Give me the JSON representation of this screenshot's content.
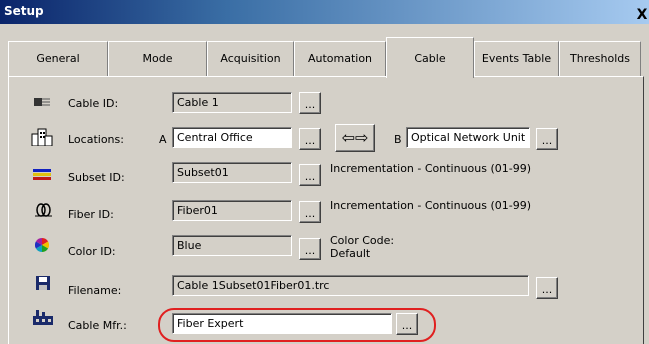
{
  "window": {
    "title": "Setup",
    "close_glyph": "X"
  },
  "tabs": [
    {
      "label": "General"
    },
    {
      "label": "Mode"
    },
    {
      "label": "Acquisition"
    },
    {
      "label": "Automation"
    },
    {
      "label": "Cable",
      "active": true
    },
    {
      "label": "Events Table"
    },
    {
      "label": "Thresholds"
    }
  ],
  "rows": {
    "cable_id": {
      "icon": "cable-icon",
      "label": "Cable ID:",
      "value": "Cable 1",
      "button": "..."
    },
    "locations": {
      "icon": "buildings-icon",
      "label": "Locations:",
      "a_prefix": "A",
      "a_value": "Central Office",
      "a_button": "...",
      "swap_glyph": "⇦⇨",
      "b_prefix": "B",
      "b_value": "Optical Network Unit",
      "b_button": "..."
    },
    "subset_id": {
      "icon": "color-stripes-icon",
      "label": "Subset ID:",
      "value": "Subset01",
      "button": "...",
      "info": "Incrementation - Continuous (01-99)"
    },
    "fiber_id": {
      "icon": "fiber-icon",
      "label": "Fiber ID:",
      "value": "Fiber01",
      "button": "...",
      "info": "Incrementation - Continuous (01-99)"
    },
    "color_id": {
      "icon": "color-wheel-icon",
      "label": "Color ID:",
      "value": "Blue",
      "button": "...",
      "info_line1": "Color Code:",
      "info_line2": "Default"
    },
    "filename": {
      "icon": "floppy-icon",
      "label": "Filename:",
      "value": "Cable 1Subset01Fiber01.trc",
      "button": "..."
    },
    "cable_mfr": {
      "icon": "factory-icon",
      "label": "Cable Mfr.:",
      "value": "Fiber Expert",
      "button": "..."
    }
  },
  "colors": {
    "highlight": "#e02020",
    "title_start": "#0a246a",
    "title_end": "#a6caf0",
    "dialog_bg": "#d4d0c8"
  }
}
